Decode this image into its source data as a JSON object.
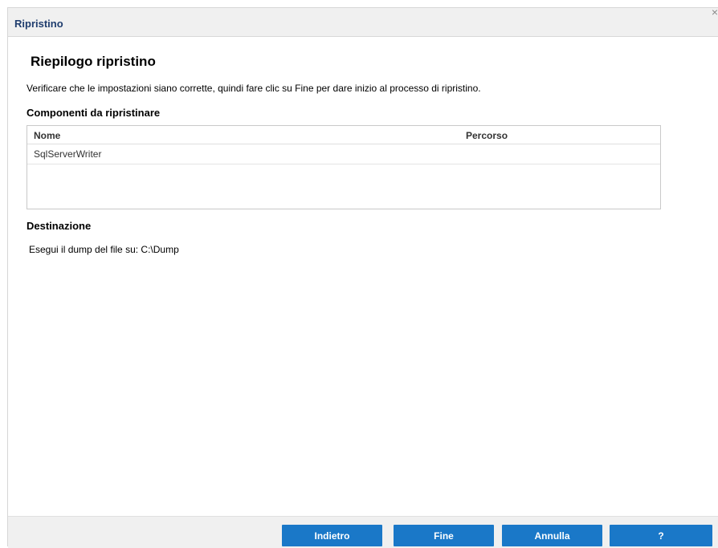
{
  "window": {
    "title": "Ripristino",
    "close_glyph": "×",
    "close_icon": "close-icon"
  },
  "main": {
    "heading": "Riepilogo ripristino",
    "instructions": "Verificare che le impostazioni siano corrette, quindi fare clic su Fine per dare inizio al processo di ripristino.",
    "components": {
      "label": "Componenti da ripristinare",
      "columns": [
        "Nome",
        "Percorso"
      ],
      "rows": [
        {
          "name": "SqlServerWriter",
          "path": ""
        }
      ]
    },
    "destination": {
      "label": "Destinazione",
      "text": "Esegui il dump del file su: C:\\Dump"
    }
  },
  "footer": {
    "back_label": "Indietro",
    "finish_label": "Fine",
    "cancel_label": "Annulla",
    "help_label": "?"
  },
  "colors": {
    "button_bg": "#1a78c8",
    "title_color": "#1f3d6e",
    "titlebar_bg": "#f0f0f0"
  }
}
